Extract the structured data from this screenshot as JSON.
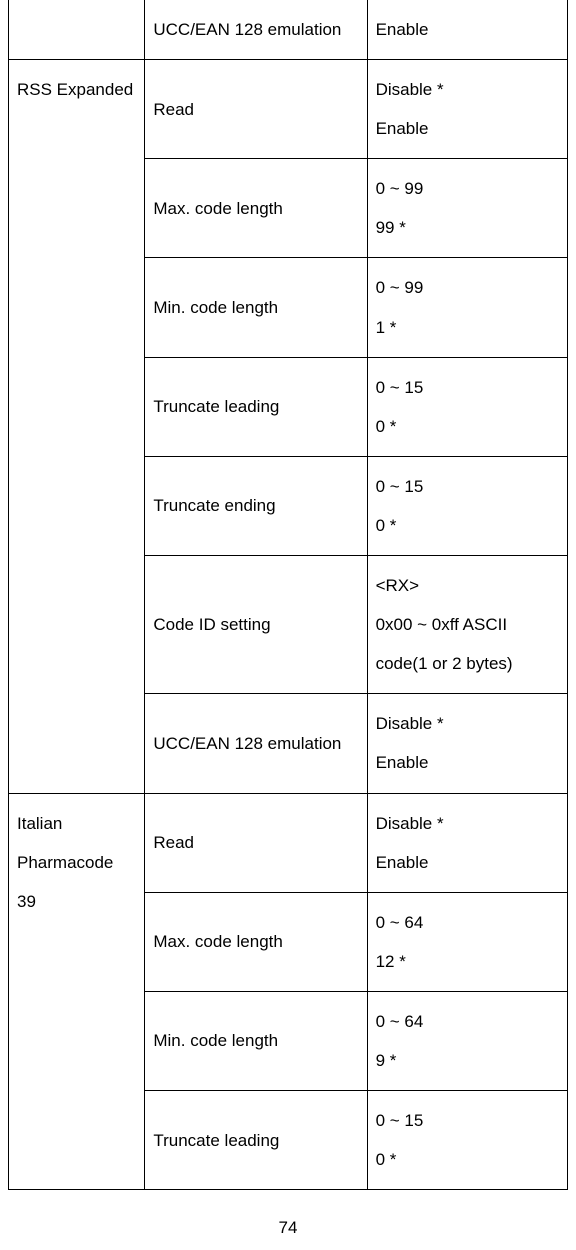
{
  "page_number": "74",
  "r0": {
    "c1": "",
    "c2": "UCC/EAN 128 emulation",
    "c3": "Enable"
  },
  "rss": {
    "label": "RSS Expanded",
    "rows": [
      {
        "c2": "Read",
        "c3": "Disable *\nEnable"
      },
      {
        "c2": "Max. code length",
        "c3": "0 ~ 99\n99 *"
      },
      {
        "c2": "Min. code length",
        "c3": "0 ~ 99\n1 *"
      },
      {
        "c2": "Truncate leading",
        "c3": "0 ~ 15\n0 *"
      },
      {
        "c2": "Truncate ending",
        "c3": "0 ~ 15\n0 *"
      },
      {
        "c2": "Code ID setting",
        "c3": "<RX>\n0x00 ~ 0xff ASCII code(1 or 2 bytes)"
      },
      {
        "c2": "UCC/EAN 128 emulation",
        "c3": "Disable *\nEnable"
      }
    ]
  },
  "ita": {
    "label": "Italian Pharmacode 39",
    "rows": [
      {
        "c2": "Read",
        "c3": "Disable *\nEnable"
      },
      {
        "c2": "Max. code length",
        "c3": "0 ~ 64\n12 *"
      },
      {
        "c2": "Min. code length",
        "c3": "0 ~ 64\n9 *"
      },
      {
        "c2": "Truncate leading",
        "c3": "0 ~ 15\n0 *"
      }
    ]
  }
}
